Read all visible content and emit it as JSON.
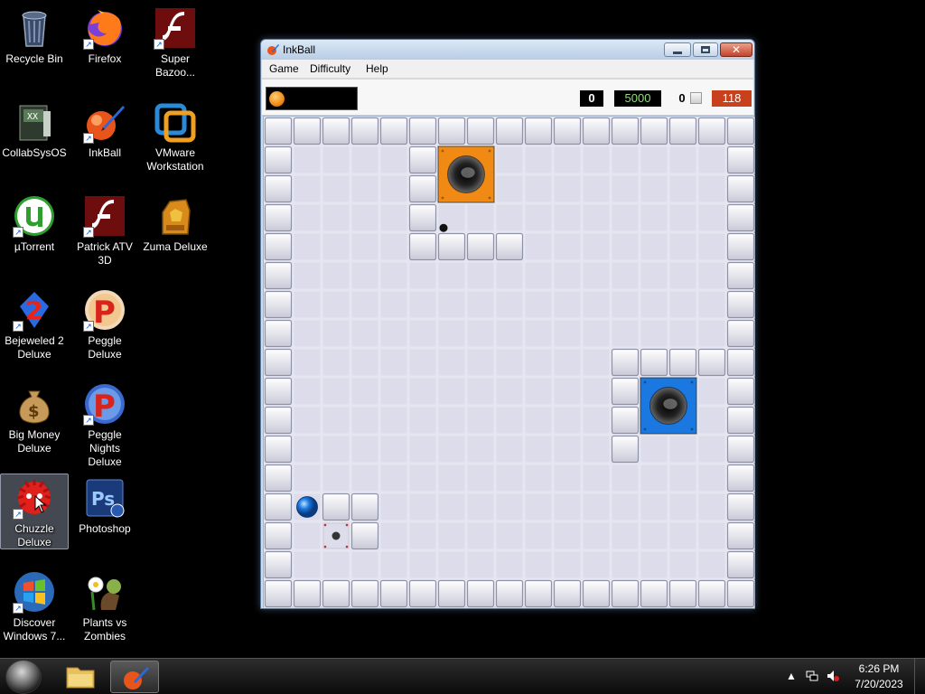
{
  "desktop": {
    "icons": [
      {
        "label": "Recycle Bin",
        "icon": "recycle-bin-icon"
      },
      {
        "label": "Firefox",
        "icon": "firefox-icon"
      },
      {
        "label": "Super\nBazoo...",
        "icon": "flash-icon"
      },
      {
        "label": "CollabSysOS",
        "icon": "collabsysos-icon"
      },
      {
        "label": "InkBall",
        "icon": "inkball-icon"
      },
      {
        "label": "VMware\nWorkstation",
        "icon": "vmware-icon"
      },
      {
        "label": "µTorrent",
        "icon": "utorrent-icon"
      },
      {
        "label": "Patrick ATV\n3D",
        "icon": "flash-icon"
      },
      {
        "label": "Zuma Deluxe",
        "icon": "zuma-icon"
      },
      {
        "label": "Bejeweled 2\nDeluxe",
        "icon": "bejeweled-icon"
      },
      {
        "label": "Peggle Deluxe",
        "icon": "peggle-icon"
      },
      {
        "label": "Big Money\nDeluxe",
        "icon": "money-bag-icon"
      },
      {
        "label": "Peggle Nights\nDeluxe",
        "icon": "peggle-nights-icon"
      },
      {
        "label": "Chuzzle\nDeluxe",
        "icon": "chuzzle-icon"
      },
      {
        "label": "Photoshop",
        "icon": "photoshop-icon"
      },
      {
        "label": "Discover\nWindows 7...",
        "icon": "windows-logo-icon"
      },
      {
        "label": "Plants vs\nZombies",
        "icon": "plants-vs-zombies-icon"
      }
    ]
  },
  "window": {
    "title": "InkBall",
    "menus": [
      "Game",
      "Difficulty",
      "Help"
    ],
    "close_glyph": "✕"
  },
  "scoreboard": {
    "balls_lost": "0",
    "score": "5000",
    "balls_captured": "0",
    "time": "118"
  },
  "colors": {
    "orange": "#f08a14",
    "blue": "#1a78e0",
    "tile": "#dcdcea",
    "timer": "#c8401c"
  },
  "board": {
    "cols": 17,
    "rows": 17,
    "walls": [
      [
        0,
        0
      ],
      [
        1,
        0
      ],
      [
        2,
        0
      ],
      [
        3,
        0
      ],
      [
        4,
        0
      ],
      [
        5,
        0
      ],
      [
        6,
        0
      ],
      [
        7,
        0
      ],
      [
        8,
        0
      ],
      [
        9,
        0
      ],
      [
        10,
        0
      ],
      [
        11,
        0
      ],
      [
        12,
        0
      ],
      [
        13,
        0
      ],
      [
        14,
        0
      ],
      [
        15,
        0
      ],
      [
        16,
        0
      ],
      [
        0,
        16
      ],
      [
        1,
        16
      ],
      [
        2,
        16
      ],
      [
        3,
        16
      ],
      [
        4,
        16
      ],
      [
        5,
        16
      ],
      [
        6,
        16
      ],
      [
        7,
        16
      ],
      [
        8,
        16
      ],
      [
        9,
        16
      ],
      [
        10,
        16
      ],
      [
        11,
        16
      ],
      [
        12,
        16
      ],
      [
        13,
        16
      ],
      [
        14,
        16
      ],
      [
        15,
        16
      ],
      [
        16,
        16
      ],
      [
        0,
        1
      ],
      [
        0,
        2
      ],
      [
        0,
        3
      ],
      [
        0,
        4
      ],
      [
        0,
        5
      ],
      [
        0,
        6
      ],
      [
        0,
        7
      ],
      [
        0,
        8
      ],
      [
        0,
        9
      ],
      [
        0,
        10
      ],
      [
        0,
        11
      ],
      [
        0,
        12
      ],
      [
        0,
        13
      ],
      [
        0,
        14
      ],
      [
        0,
        15
      ],
      [
        16,
        1
      ],
      [
        16,
        2
      ],
      [
        16,
        3
      ],
      [
        16,
        4
      ],
      [
        16,
        5
      ],
      [
        16,
        6
      ],
      [
        16,
        7
      ],
      [
        16,
        8
      ],
      [
        16,
        9
      ],
      [
        16,
        10
      ],
      [
        16,
        11
      ],
      [
        16,
        12
      ],
      [
        16,
        13
      ],
      [
        16,
        14
      ],
      [
        16,
        15
      ],
      [
        5,
        1
      ],
      [
        5,
        2
      ],
      [
        5,
        3
      ],
      [
        5,
        4
      ],
      [
        6,
        4
      ],
      [
        7,
        4
      ],
      [
        8,
        4
      ],
      [
        12,
        8
      ],
      [
        13,
        8
      ],
      [
        14,
        8
      ],
      [
        15,
        8
      ],
      [
        12,
        9
      ],
      [
        12,
        10
      ],
      [
        12,
        11
      ],
      [
        2,
        13
      ],
      [
        3,
        13
      ],
      [
        3,
        14
      ]
    ],
    "holes": [
      {
        "col": 6,
        "row": 1,
        "color": "orange"
      },
      {
        "col": 13,
        "row": 9,
        "color": "blue"
      }
    ],
    "balls": [
      {
        "col": 1,
        "row": 13,
        "color": "blue"
      }
    ],
    "spawner": {
      "col": 2,
      "row": 14
    },
    "ink_dot": {
      "col": 6,
      "row": 3.85
    }
  },
  "taskbar": {
    "items": [
      "windows-explorer-icon",
      "inkball-icon"
    ],
    "active": "inkball-icon",
    "clock_time": "6:26 PM",
    "clock_date": "7/20/2023"
  }
}
